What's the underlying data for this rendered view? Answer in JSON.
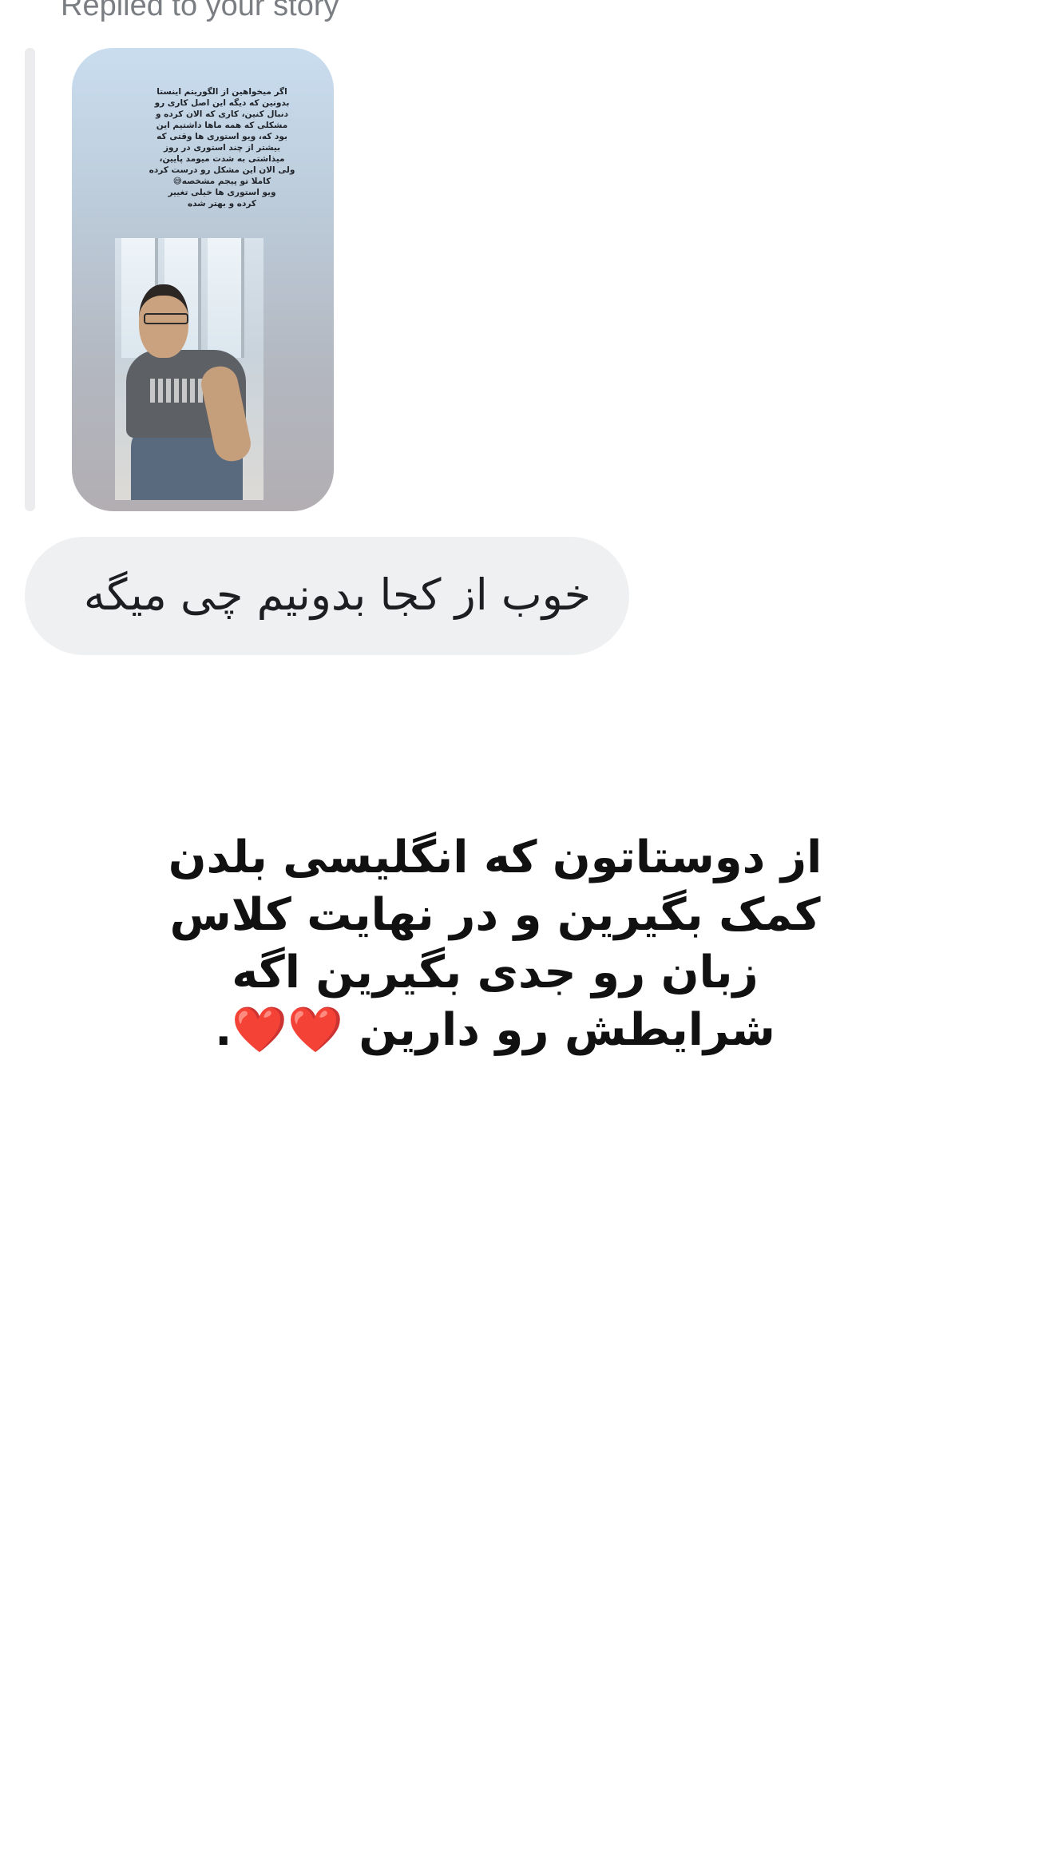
{
  "reply": {
    "label": "Replied to your story"
  },
  "story": {
    "caption_lines": [
      "اگر میخواهین از الگوریتم اینستا",
      "بدونین که دیگه این اصل کاری رو",
      "دنبال کنین، کاری که الان کرده و",
      "مشکلی که همه ماها داشتیم این",
      "بود که، ویو استوری ها وقتی که",
      "بیشتر از چند استوری در روز",
      "میذاشتی به شدت میومد پایین،",
      "ولی الان این مشکل رو درست کرده",
      "کاملا تو پیجم مشخصه😅",
      "ویو استوری ها خیلی تغییر",
      "کرده و بهتر شده"
    ]
  },
  "message": {
    "text": "خوب از کجا بدونیم چی میگه"
  },
  "caption": {
    "lines": [
      "از دوستاتون که انگلیسی بلدن",
      "کمک بگیرین و در نهایت کلاس",
      "زبان رو جدی بگیرین اگه",
      "شرایطش رو دارین ❤️❤️."
    ]
  },
  "colors": {
    "bubble": "#eff0f2",
    "secondary_text": "#7a7d82"
  }
}
